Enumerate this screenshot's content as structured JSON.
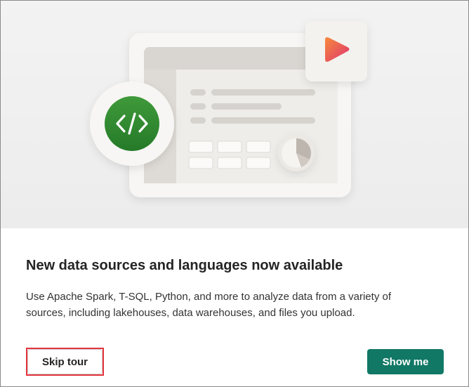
{
  "dialog": {
    "title": "New data sources and languages now available",
    "description": "Use Apache Spark, T-SQL, Python, and more to analyze data from a variety of sources, including lakehouses, data warehouses, and files you upload.",
    "skip_label": "Skip tour",
    "show_label": "Show me"
  },
  "illustration": {
    "code_icon": "code-brackets-icon",
    "play_icon": "play-icon",
    "chart_icon": "pie-chart-icon",
    "colors": {
      "code_green": "#2e8b2e",
      "play_orange": "#f27a45",
      "play_pink": "#e23d6b",
      "primary_button": "#117865",
      "highlight_red": "#e3343c"
    }
  }
}
